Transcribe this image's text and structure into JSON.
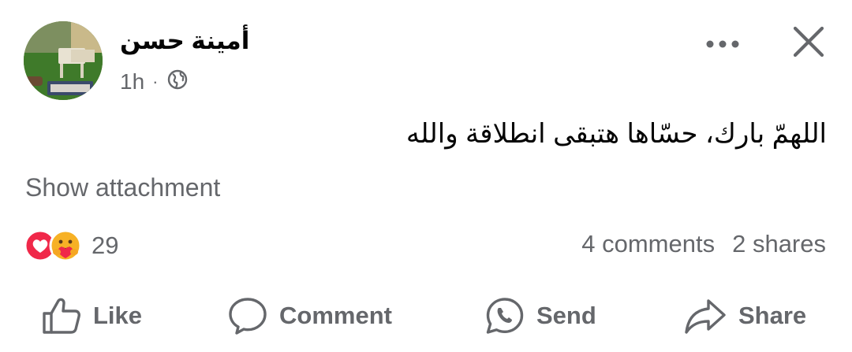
{
  "post": {
    "author": "أمينة حسن",
    "time": "1h",
    "separator": "·",
    "privacy_icon": "globe-icon",
    "text": "اللهمّ بارك، حسّاها هتبقى انطلاقة والله",
    "show_attachment": "Show attachment"
  },
  "reactions": {
    "icons": [
      "love-reaction-icon",
      "care-reaction-icon"
    ],
    "count": "29",
    "comments": "4 comments",
    "shares": "2 shares"
  },
  "actions": {
    "like": "Like",
    "comment": "Comment",
    "send": "Send",
    "share": "Share"
  },
  "colors": {
    "text_primary": "#050505",
    "text_secondary": "#65676b",
    "love_red": "#f02849",
    "care_yellow": "#f7b125"
  }
}
